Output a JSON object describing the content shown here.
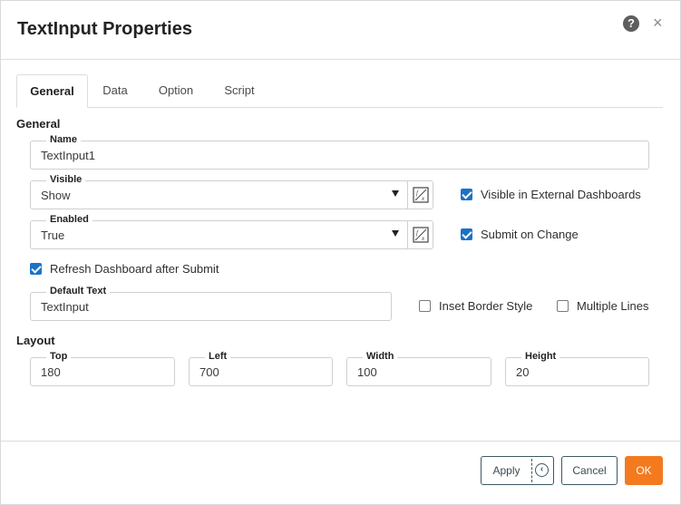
{
  "dialog": {
    "title": "TextInput Properties",
    "help_glyph": "?",
    "close_glyph": "×"
  },
  "tabs": [
    {
      "label": "General",
      "active": true
    },
    {
      "label": "Data",
      "active": false
    },
    {
      "label": "Option",
      "active": false
    },
    {
      "label": "Script",
      "active": false
    }
  ],
  "general": {
    "heading": "General",
    "name": {
      "label": "Name",
      "value": "TextInput1"
    },
    "visible": {
      "label": "Visible",
      "value": "Show"
    },
    "visible_external": {
      "label": "Visible in External Dashboards",
      "checked": true
    },
    "enabled": {
      "label": "Enabled",
      "value": "True"
    },
    "submit_on_change": {
      "label": "Submit on Change",
      "checked": true
    },
    "refresh_after_submit": {
      "label": "Refresh Dashboard after Submit",
      "checked": true
    },
    "default_text": {
      "label": "Default Text",
      "value": "TextInput"
    },
    "inset_border": {
      "label": "Inset Border Style",
      "checked": false
    },
    "multiple_lines": {
      "label": "Multiple Lines",
      "checked": false
    }
  },
  "layout": {
    "heading": "Layout",
    "top": {
      "label": "Top",
      "value": "180"
    },
    "left": {
      "label": "Left",
      "value": "700"
    },
    "width": {
      "label": "Width",
      "value": "100"
    },
    "height": {
      "label": "Height",
      "value": "20"
    }
  },
  "footer": {
    "apply_label": "Apply",
    "cancel_label": "Cancel",
    "ok_label": "OK"
  },
  "icons": {
    "formula": "formula-fx-icon",
    "apply_history": "history-back-icon"
  },
  "colors": {
    "accent_blue": "#1a73c7",
    "ok_orange": "#f47a20"
  }
}
